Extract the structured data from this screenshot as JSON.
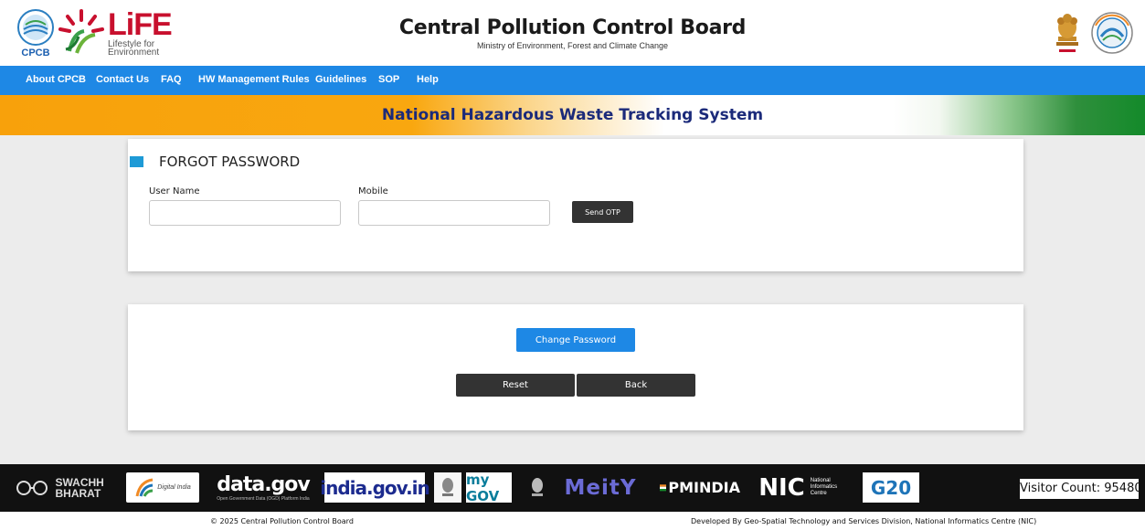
{
  "header": {
    "title": "Central Pollution Control Board",
    "subtitle": "Ministry of Environment, Forest and Climate Change",
    "cpcb_logo_text": "CPCB",
    "life_logo": {
      "main": "LiFE",
      "line1": "Lifestyle for",
      "line2": "Environment"
    }
  },
  "nav": {
    "items": [
      {
        "label": "About CPCB"
      },
      {
        "label": "Contact Us"
      },
      {
        "label": "FAQ"
      },
      {
        "label": "HW Management Rules"
      },
      {
        "label": "Guidelines"
      },
      {
        "label": "SOP"
      },
      {
        "label": "Help"
      }
    ]
  },
  "banner": {
    "title": "National Hazardous Waste Tracking System"
  },
  "form": {
    "section_title": "FORGOT PASSWORD",
    "username": {
      "label": "User Name",
      "value": "",
      "placeholder": ""
    },
    "mobile": {
      "label": "Mobile",
      "value": "",
      "placeholder": ""
    },
    "send_otp": "Send OTP"
  },
  "actions": {
    "change_password": "Change Password",
    "reset": "Reset",
    "back": "Back"
  },
  "footer": {
    "logos": {
      "swachh": "SWACHH BHARAT",
      "digital_india": "Digital India",
      "datagov": "data.gov",
      "datagov_sub": "Open Government Data (OGD) Platform India",
      "indiagov": "india.gov.in",
      "mygov": "my GOV",
      "meity": "MeitY",
      "pmindia": "PMINDIA",
      "nic": "NIC",
      "nic_sub": "National Informatics Centre",
      "g20": "G20"
    },
    "visitor_count": "Visitor Count: 95480",
    "copyright": "© 2025 Central Pollution Control Board",
    "developed_by": "Developed By Geo-Spatial Technology and Services Division, National Informatics Centre (NIC)"
  },
  "colors": {
    "nav": "#1e88e5",
    "banner_orange": "#f8a10b",
    "banner_green": "#138a2a",
    "banner_text": "#1b2a7a",
    "dark_button": "#333333",
    "section_marker": "#1e9ad6"
  }
}
